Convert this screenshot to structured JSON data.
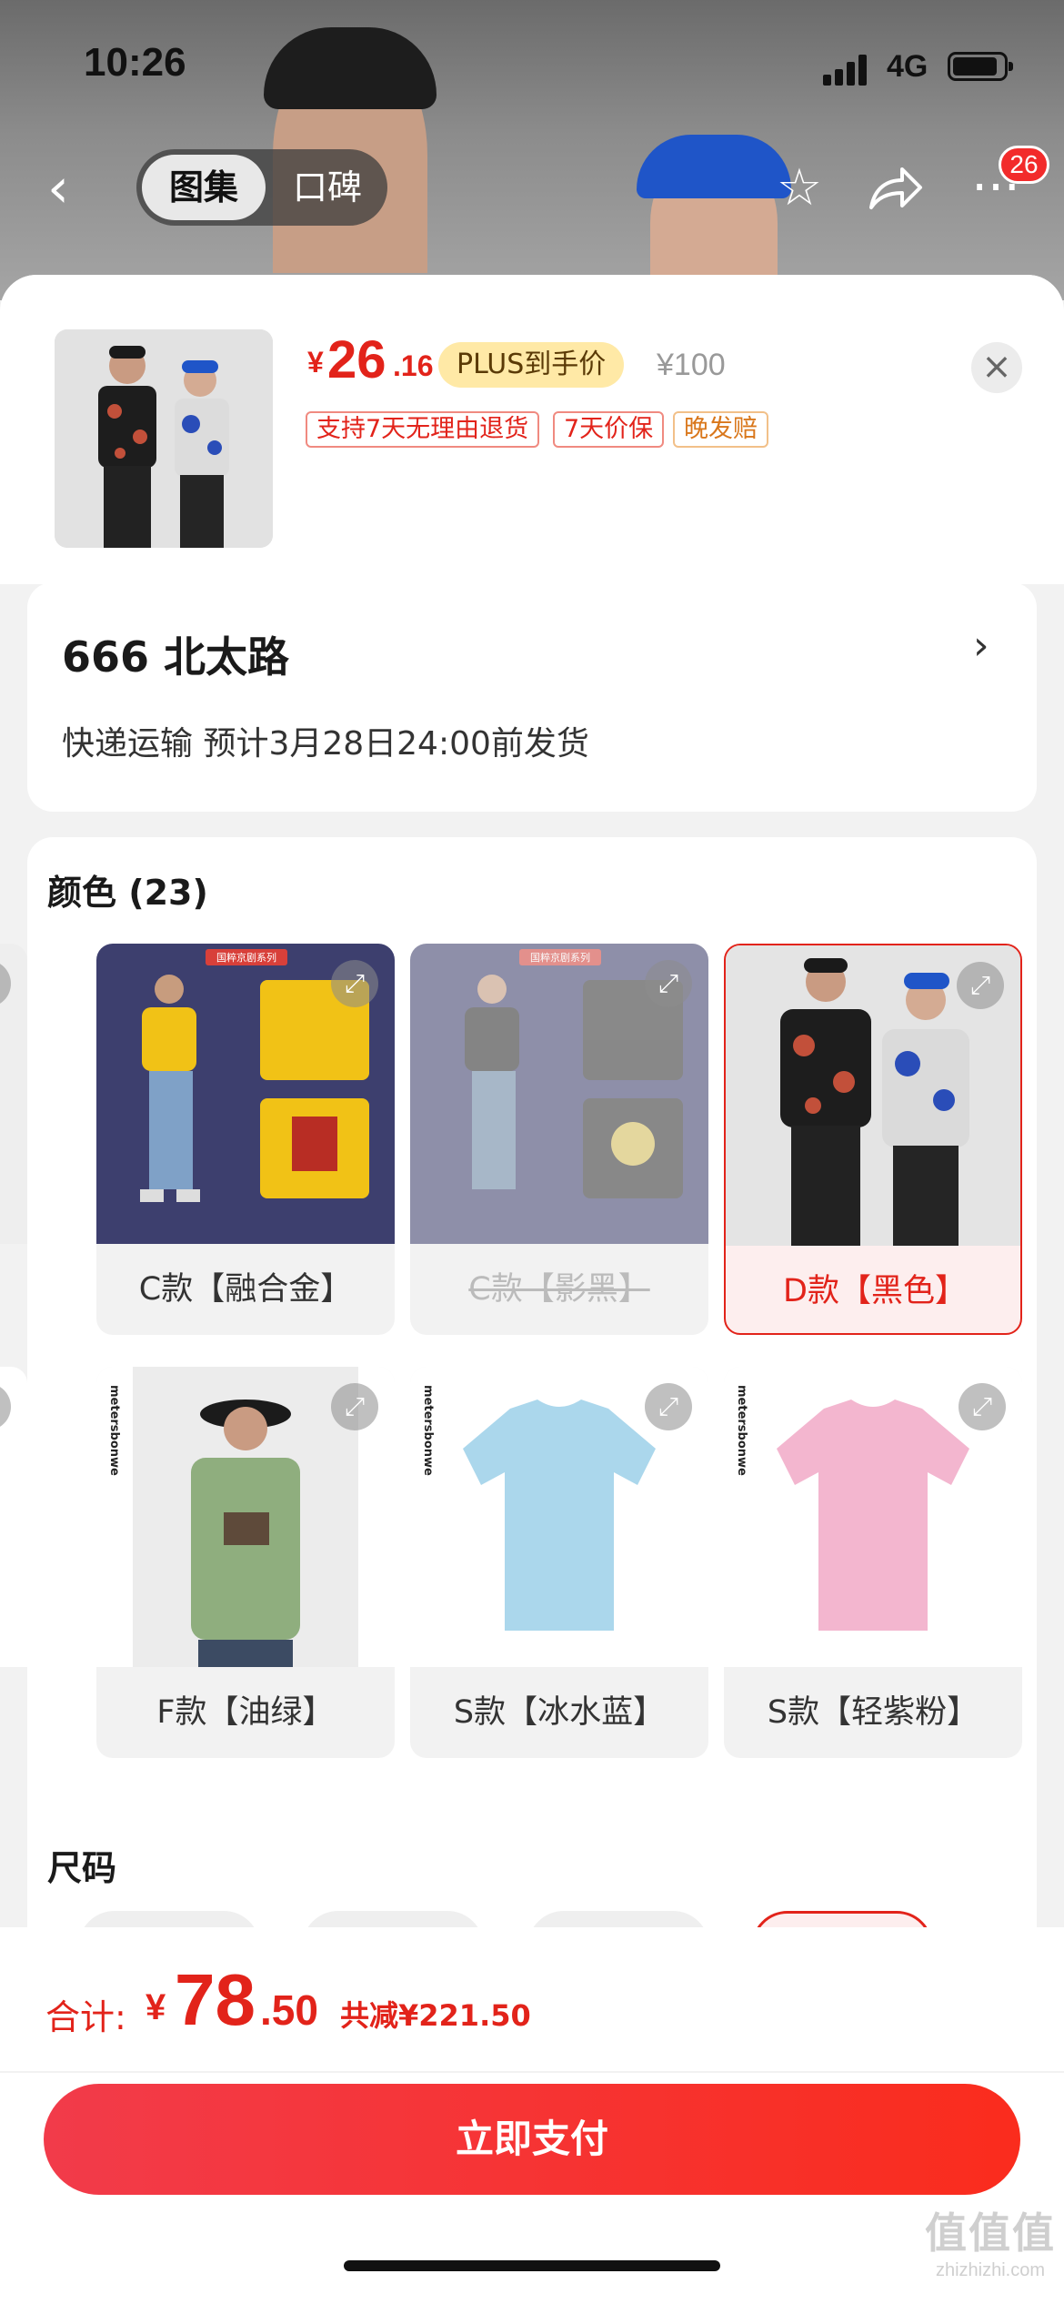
{
  "status_bar": {
    "time": "10:26",
    "network": "4G"
  },
  "nav": {
    "tabs": [
      {
        "label": "图集",
        "active": true
      },
      {
        "label": "口碑",
        "active": false
      }
    ],
    "cart_badge": "26",
    "icons": [
      "back-icon",
      "star-icon",
      "share-icon",
      "more-icon"
    ]
  },
  "product": {
    "price_currency": "¥",
    "price_integer": "26",
    "price_decimal": ".16",
    "plus_tag": "PLUS到手价",
    "original_price": "¥100",
    "services": [
      "支持7天无理由退货",
      "7天价保",
      "晚发赔"
    ]
  },
  "address": {
    "title": "666  北太路",
    "delivery": "快递运输 预计3月28日24:00前发货"
  },
  "colors": {
    "title": "颜色 (23)",
    "row1": [
      {
        "label": "C款【融合金】",
        "state": "normal"
      },
      {
        "label": "C款【影黑】",
        "state": "disabled"
      },
      {
        "label": "D款【黑色】",
        "state": "selected"
      }
    ],
    "row2": [
      {
        "label": "F款【油绿】",
        "state": "normal"
      },
      {
        "label": "S款【冰水蓝】",
        "state": "normal"
      },
      {
        "label": "S款【轻紫粉】",
        "state": "normal"
      }
    ],
    "image_text": {
      "series_banner": "国粹京剧系列",
      "brand": "metersbonwe"
    }
  },
  "sizes": {
    "title": "尺码"
  },
  "footer": {
    "total_label": "合计:",
    "total_currency": "¥",
    "total_integer": "78",
    "total_decimal": ".50",
    "saving": "共减¥221.50",
    "pay_button": "立即支付"
  },
  "watermark": {
    "logo": "值值值",
    "url": "zhizhizhi.com"
  },
  "colors_theme": {
    "accent": "#e2231a",
    "plus": "#ffe9a6",
    "gold_text": "#d9771b"
  }
}
